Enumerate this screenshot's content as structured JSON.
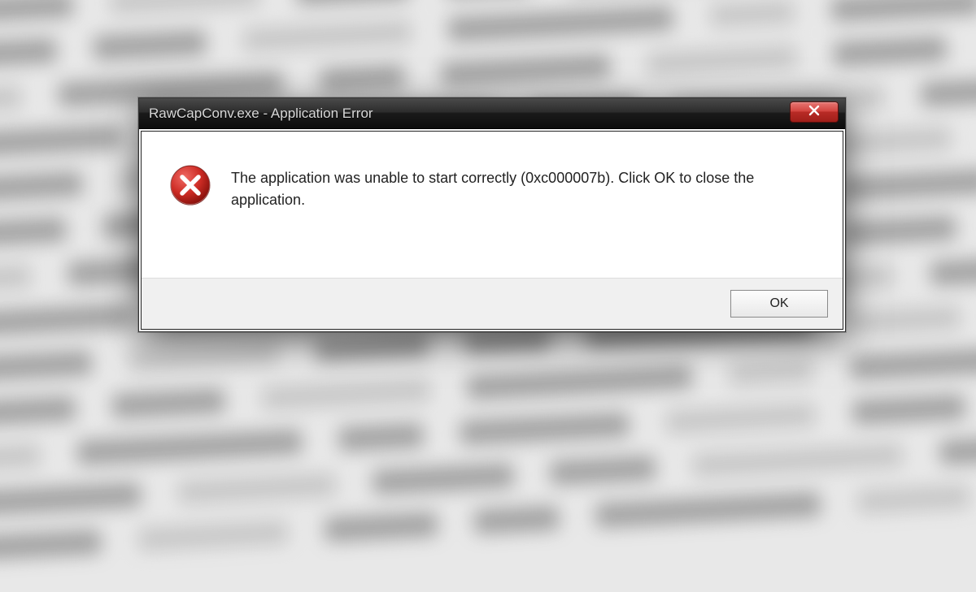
{
  "dialog": {
    "title": "RawCapConv.exe - Application Error",
    "message": "The application was unable to start correctly (0xc000007b). Click OK to close the application.",
    "ok_label": "OK"
  }
}
